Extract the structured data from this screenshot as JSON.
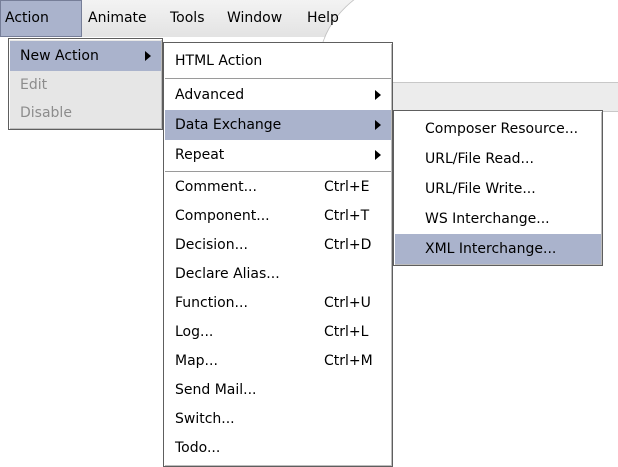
{
  "menubar": {
    "items": [
      "Action",
      "Animate",
      "Tools",
      "Window",
      "Help"
    ]
  },
  "action_menu": {
    "items": [
      {
        "label": "New Action",
        "has_submenu": true,
        "enabled": true
      },
      {
        "label": "Edit",
        "enabled": false
      },
      {
        "label": "Disable",
        "enabled": false
      }
    ]
  },
  "new_action_menu": {
    "items": [
      {
        "label": "HTML Action"
      },
      {
        "label": "Advanced",
        "has_submenu": true
      },
      {
        "label": "Data Exchange",
        "has_submenu": true
      },
      {
        "label": "Repeat",
        "has_submenu": true
      },
      {
        "label": "Comment...",
        "shortcut": "Ctrl+E"
      },
      {
        "label": "Component...",
        "shortcut": "Ctrl+T"
      },
      {
        "label": "Decision...",
        "shortcut": "Ctrl+D"
      },
      {
        "label": "Declare Alias..."
      },
      {
        "label": "Function...",
        "shortcut": "Ctrl+U"
      },
      {
        "label": "Log...",
        "shortcut": "Ctrl+L"
      },
      {
        "label": "Map...",
        "shortcut": "Ctrl+M"
      },
      {
        "label": "Send Mail..."
      },
      {
        "label": "Switch..."
      },
      {
        "label": "Todo..."
      }
    ]
  },
  "data_exchange_menu": {
    "items": [
      {
        "label": "Composer Resource..."
      },
      {
        "label": "URL/File Read..."
      },
      {
        "label": "URL/File Write..."
      },
      {
        "label": "WS Interchange..."
      },
      {
        "label": "XML Interchange..."
      }
    ]
  },
  "colors": {
    "highlight": "#aab3cc",
    "disabled_text": "#8c8c8c",
    "menubar": "#e8e8e8"
  }
}
